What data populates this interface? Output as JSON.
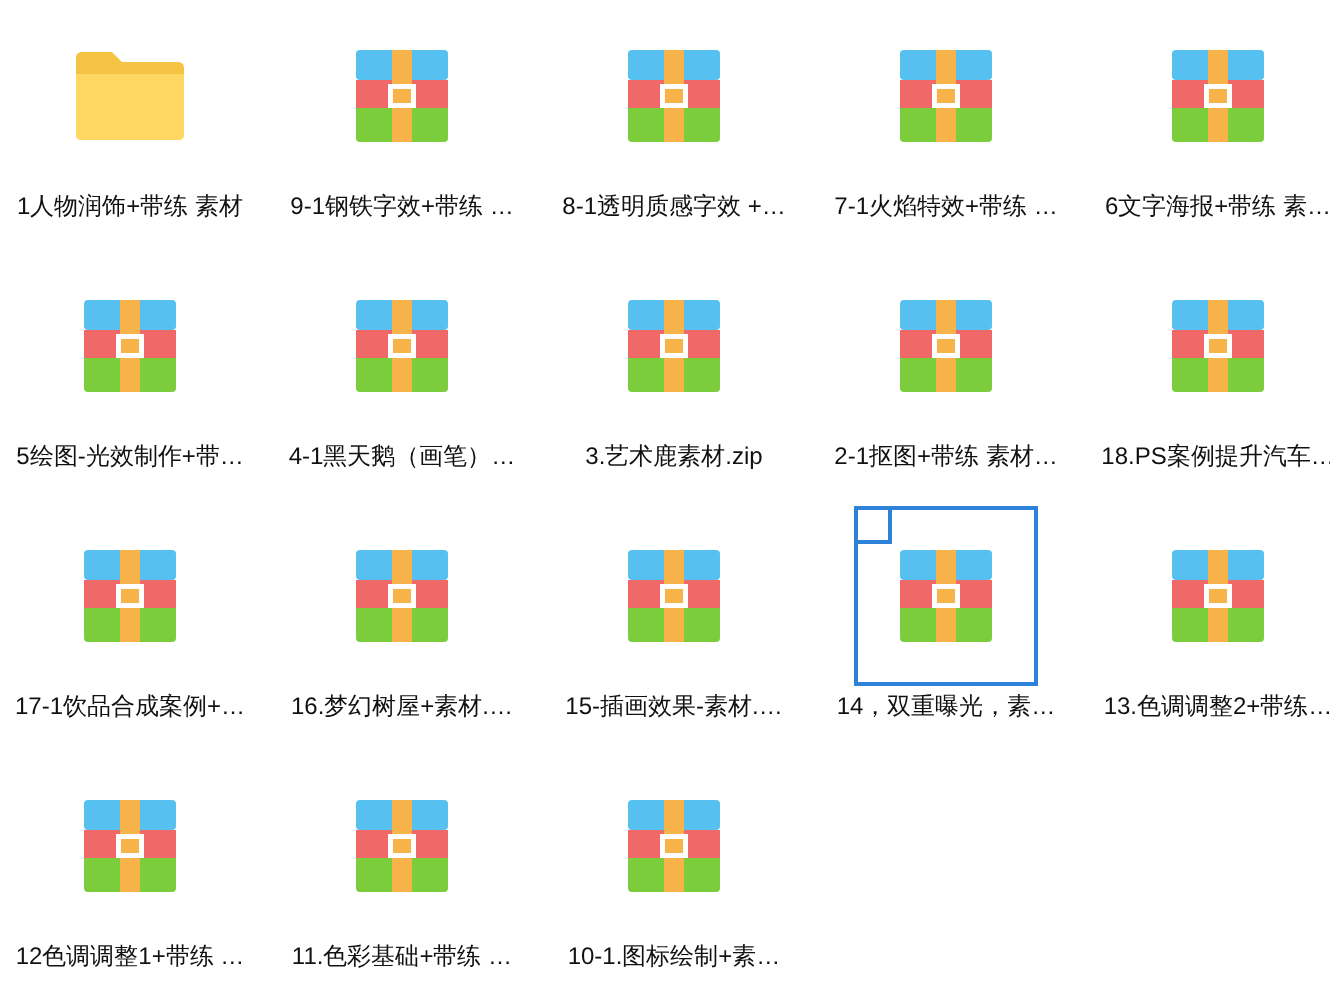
{
  "items": [
    {
      "kind": "folder",
      "label": "1人物润饰+带练 素材",
      "selected": false
    },
    {
      "kind": "archive",
      "label": "9-1钢铁字效+带练 …",
      "selected": false
    },
    {
      "kind": "archive",
      "label": "8-1透明质感字效 +…",
      "selected": false
    },
    {
      "kind": "archive",
      "label": "7-1火焰特效+带练 …",
      "selected": false
    },
    {
      "kind": "archive",
      "label": "6文字海报+带练 素…",
      "selected": false
    },
    {
      "kind": "archive",
      "label": "5绘图-光效制作+带…",
      "selected": false
    },
    {
      "kind": "archive",
      "label": "4-1黑天鹅（画笔）…",
      "selected": false
    },
    {
      "kind": "archive",
      "label": "3.艺术鹿素材.zip",
      "selected": false
    },
    {
      "kind": "archive",
      "label": "2-1抠图+带练 素材…",
      "selected": false
    },
    {
      "kind": "archive",
      "label": "18.PS案例提升汽车…",
      "selected": false
    },
    {
      "kind": "archive",
      "label": "17-1饮品合成案例+…",
      "selected": false
    },
    {
      "kind": "archive",
      "label": "16.梦幻树屋+素材.…",
      "selected": false
    },
    {
      "kind": "archive",
      "label": "15-插画效果-素材.…",
      "selected": false
    },
    {
      "kind": "archive",
      "label": "14，双重曝光，素…",
      "selected": true
    },
    {
      "kind": "archive",
      "label": "13.色调调整2+带练…",
      "selected": false
    },
    {
      "kind": "archive",
      "label": "12色调调整1+带练 …",
      "selected": false
    },
    {
      "kind": "archive",
      "label": "11.色彩基础+带练 …",
      "selected": false
    },
    {
      "kind": "archive",
      "label": "10-1.图标绘制+素…",
      "selected": false
    }
  ]
}
